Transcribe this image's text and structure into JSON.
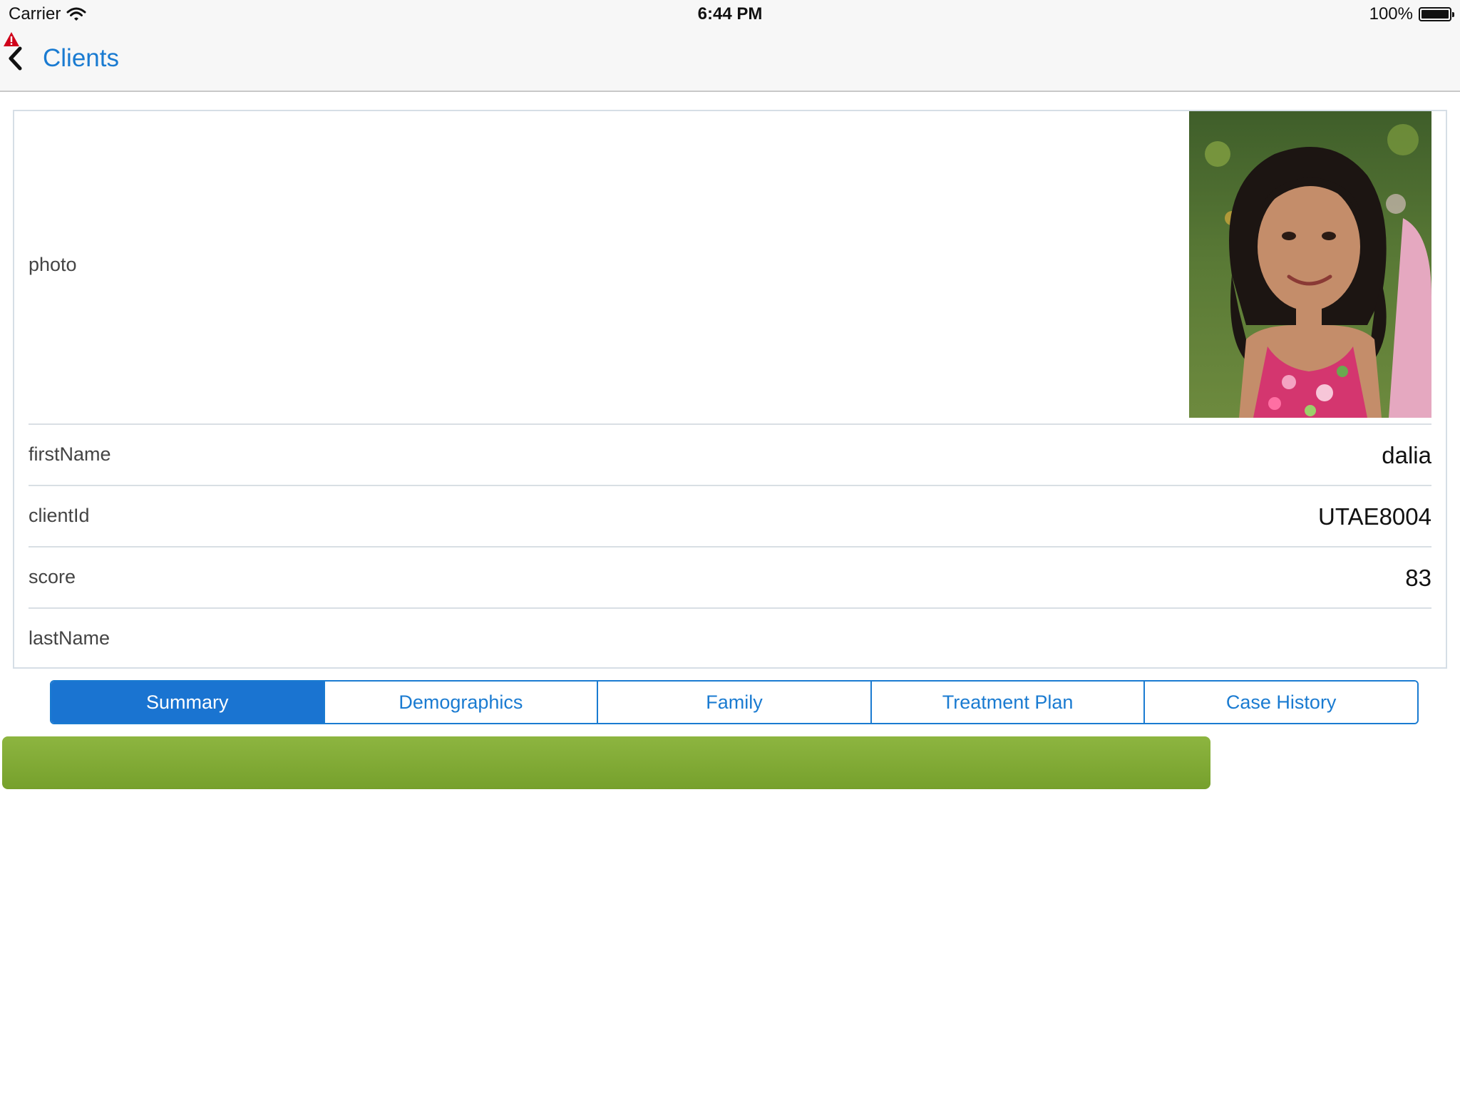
{
  "status_bar": {
    "carrier": "Carrier",
    "time": "6:44 PM",
    "battery": "100%"
  },
  "nav": {
    "back_label": "Clients"
  },
  "form": {
    "rows": [
      {
        "label": "photo",
        "value": ""
      },
      {
        "label": "firstName",
        "value": "dalia"
      },
      {
        "label": "clientId",
        "value": "UTAE8004"
      },
      {
        "label": "score",
        "value": "83"
      },
      {
        "label": "lastName",
        "value": ""
      }
    ]
  },
  "tabs": [
    {
      "label": "Summary",
      "active": true
    },
    {
      "label": "Demographics",
      "active": false
    },
    {
      "label": "Family",
      "active": false
    },
    {
      "label": "Treatment Plan",
      "active": false
    },
    {
      "label": "Case History",
      "active": false
    }
  ],
  "colors": {
    "accent": "#1a7bd1",
    "green_bar": "#84ae38",
    "warning": "#d0021b"
  },
  "icons": {
    "warning": "warning-icon",
    "back": "chevron-left-icon",
    "wifi": "wifi-icon",
    "battery": "battery-icon"
  }
}
